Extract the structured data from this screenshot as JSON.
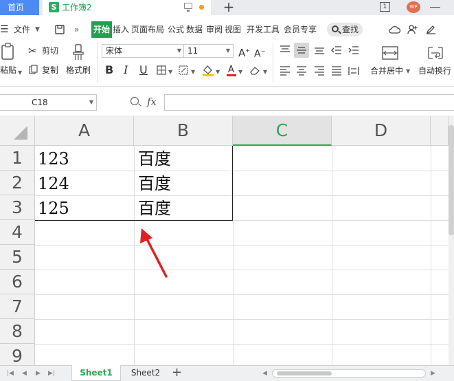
{
  "titlebar": {
    "home_tab": "首页",
    "doc_title": "工作簿2",
    "doc_icon_letter": "S",
    "new_tab": "+",
    "window_count": "1",
    "avatar_text": "WP"
  },
  "menu": {
    "file": "文件",
    "items": [
      "开始",
      "插入",
      "页面布局",
      "公式",
      "数据",
      "审阅",
      "视图",
      "开发工具",
      "会员专享"
    ],
    "search": "查找"
  },
  "ribbon": {
    "paste": "粘贴",
    "cut": "剪切",
    "copy": "复制",
    "format_painter": "格式刷",
    "font_name": "宋体",
    "font_size": "11",
    "bold": "B",
    "italic": "I",
    "underline": "U",
    "merge_center": "合并居中",
    "wrap_text": "自动换行"
  },
  "formula_bar": {
    "cell_ref": "C18",
    "fx": "fx",
    "formula": ""
  },
  "grid": {
    "columns": [
      "A",
      "B",
      "C",
      "D"
    ],
    "active_column": "C",
    "rows": [
      "1",
      "2",
      "3",
      "4",
      "5",
      "6",
      "7",
      "8",
      "9"
    ],
    "cells": [
      {
        "col": "A",
        "row": 1,
        "value": "123"
      },
      {
        "col": "B",
        "row": 1,
        "value": "百度"
      },
      {
        "col": "A",
        "row": 2,
        "value": "124"
      },
      {
        "col": "B",
        "row": 2,
        "value": "百度"
      },
      {
        "col": "A",
        "row": 3,
        "value": "125"
      },
      {
        "col": "B",
        "row": 3,
        "value": "百度"
      }
    ]
  },
  "sheets": {
    "tabs": [
      "Sheet1",
      "Sheet2"
    ],
    "active": "Sheet1",
    "add": "+"
  },
  "colors": {
    "accent_green": "#2ea65a",
    "home_tab_blue": "#4c8bf5",
    "annotation_red": "#e02020"
  }
}
